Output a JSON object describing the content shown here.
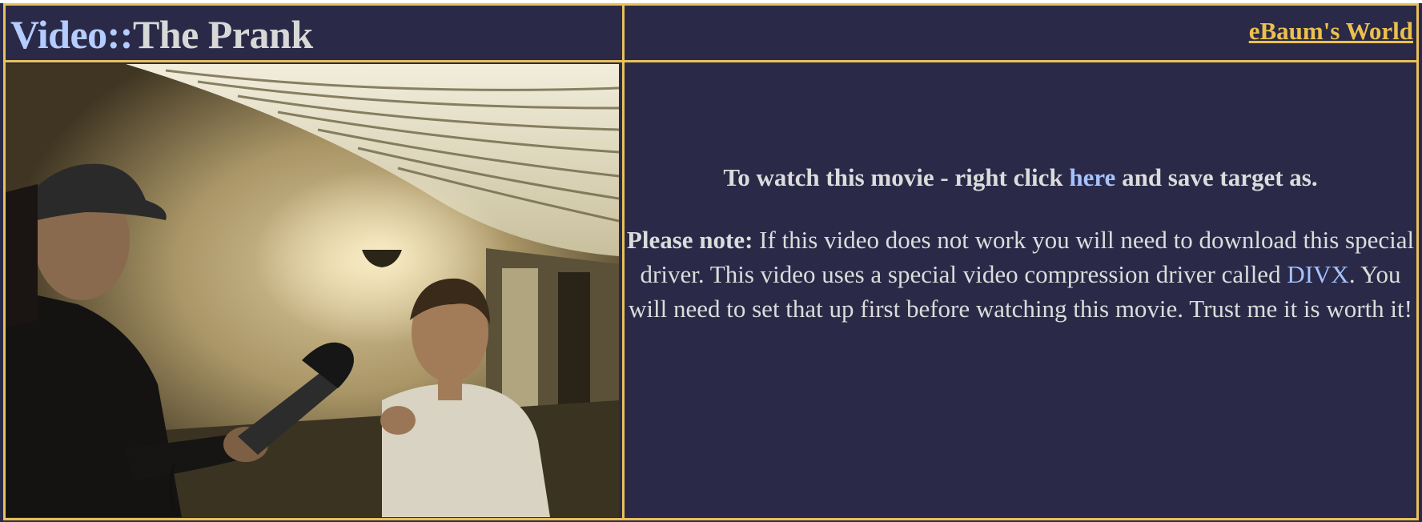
{
  "header": {
    "title_prefix": "Video::",
    "title_main": "The Prank",
    "site_link": "eBaum's World"
  },
  "video": {
    "thumbnail_icon": "video-still-image"
  },
  "info": {
    "watch_pre": "To watch this movie - right click ",
    "watch_link": "here",
    "watch_post": " and save target as.",
    "note_label": "Please note:",
    "note_text_1": " If this video does not work you will need to download this special driver. This video uses a special video compression driver called ",
    "note_link": "DIVX",
    "note_text_2": ". You will need to set that up first before watching this movie. Trust me it is worth it!"
  },
  "colors": {
    "background": "#2a2a48",
    "border": "#e8c15a",
    "link_gold": "#ecc04d",
    "link_blue": "#a6c2ff",
    "text": "#dcdcdc"
  }
}
